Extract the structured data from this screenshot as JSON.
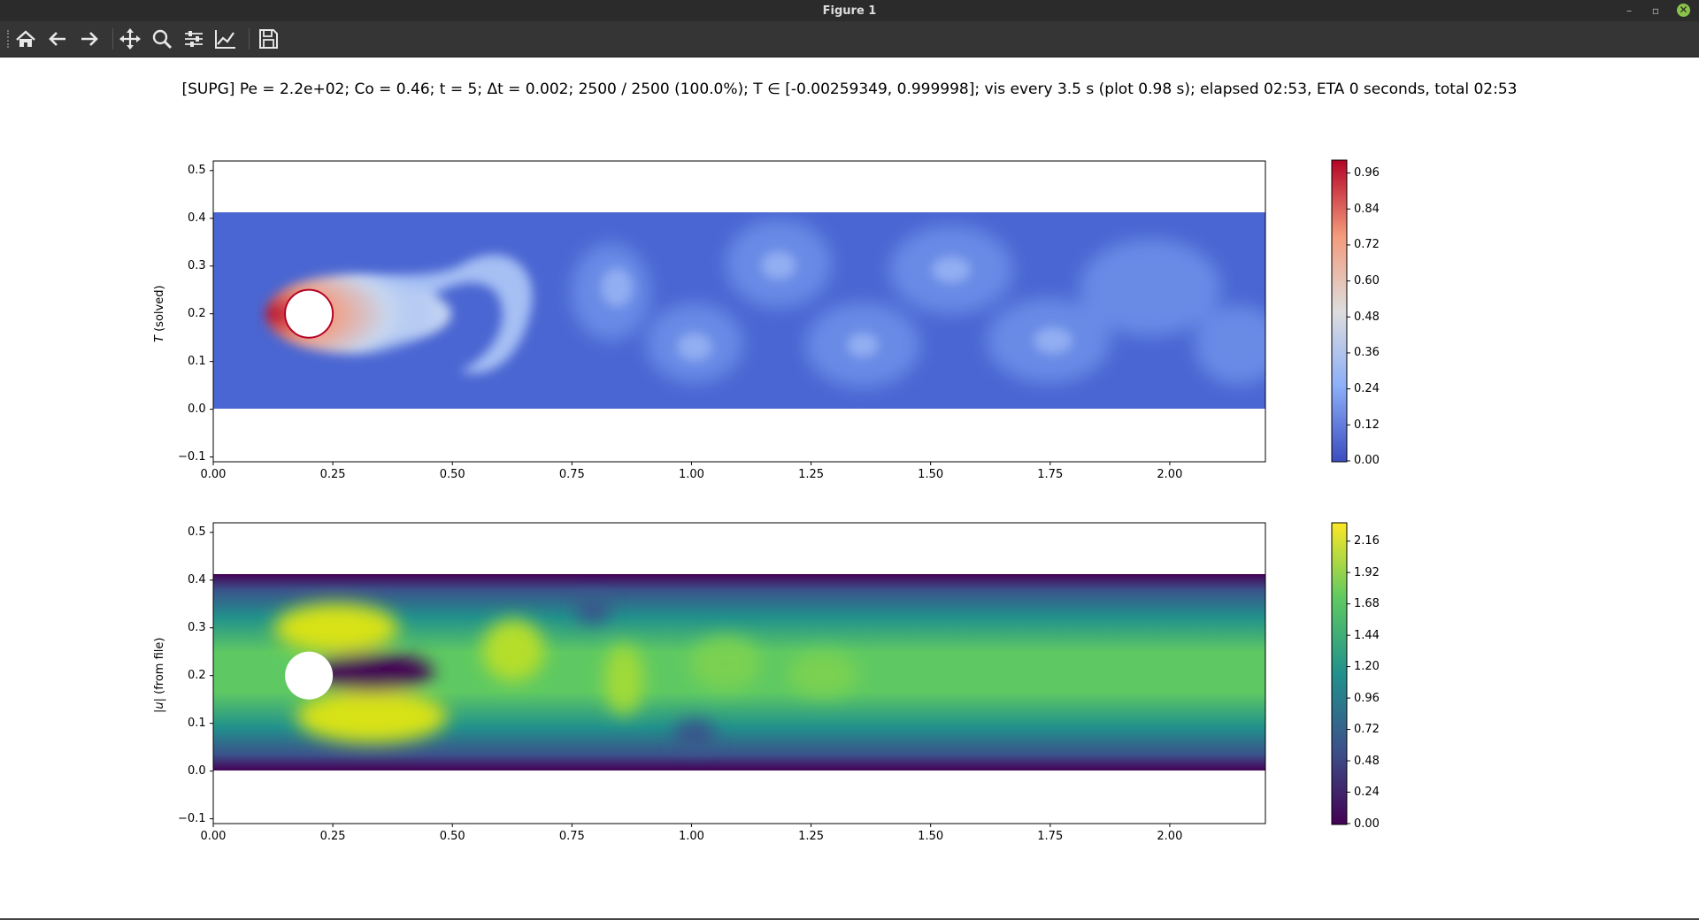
{
  "window": {
    "title": "Figure 1"
  },
  "toolbar": {
    "buttons": [
      {
        "name": "home-icon",
        "tooltip": "Home"
      },
      {
        "name": "back-icon",
        "tooltip": "Back"
      },
      {
        "name": "forward-icon",
        "tooltip": "Forward"
      },
      {
        "name": "pan-icon",
        "tooltip": "Pan"
      },
      {
        "name": "zoom-icon",
        "tooltip": "Zoom"
      },
      {
        "name": "subplots-icon",
        "tooltip": "Configure subplots"
      },
      {
        "name": "axes-edit-icon",
        "tooltip": "Edit axes"
      },
      {
        "name": "save-icon",
        "tooltip": "Save"
      }
    ]
  },
  "figure": {
    "title": "[SUPG] Pe = 2.2e+02; Co = 0.46; t = 5; Δt = 0.002; 2500 / 2500 (100.0%); T ∈ [-0.00259349, 0.999998]; vis every 3.5 s (plot 0.98 s); elapsed 02:53, ETA 0 seconds, total 02:53"
  },
  "chart_data": [
    {
      "type": "heatmap",
      "ylabel_math": "T",
      "ylabel_rest": "(solved)",
      "xlim": [
        0.0,
        2.2
      ],
      "ylim": [
        -0.11,
        0.52
      ],
      "xticks": [
        "0.00",
        "0.25",
        "0.50",
        "0.75",
        "1.00",
        "1.25",
        "1.50",
        "1.75",
        "2.00"
      ],
      "yticks": [
        "0.5",
        "0.4",
        "0.3",
        "0.2",
        "0.1",
        "0.0",
        "−0.1"
      ],
      "colormap": "coolwarm",
      "colorbar_ticks": [
        "0.96",
        "0.84",
        "0.72",
        "0.60",
        "0.48",
        "0.36",
        "0.24",
        "0.12",
        "0.00"
      ],
      "colorbar_range": [
        -0.003,
        1.0
      ],
      "domain": {
        "x": [
          0.0,
          2.2
        ],
        "y": [
          0.0,
          0.41
        ]
      },
      "obstacle": {
        "cx": 0.2,
        "cy": 0.2,
        "r": 0.05
      }
    },
    {
      "type": "heatmap",
      "ylabel_math": "|u|",
      "ylabel_rest": "(from file)",
      "xlim": [
        0.0,
        2.2
      ],
      "ylim": [
        -0.11,
        0.52
      ],
      "xticks": [
        "0.00",
        "0.25",
        "0.50",
        "0.75",
        "1.00",
        "1.25",
        "1.50",
        "1.75",
        "2.00"
      ],
      "yticks": [
        "0.5",
        "0.4",
        "0.3",
        "0.2",
        "0.1",
        "0.0",
        "−0.1"
      ],
      "colormap": "viridis",
      "colorbar_ticks": [
        "2.16",
        "1.92",
        "1.68",
        "1.44",
        "1.20",
        "0.96",
        "0.72",
        "0.48",
        "0.24",
        "0.00"
      ],
      "colorbar_range": [
        0.0,
        2.3
      ],
      "domain": {
        "x": [
          0.0,
          2.2
        ],
        "y": [
          0.0,
          0.41
        ]
      },
      "obstacle": {
        "cx": 0.2,
        "cy": 0.2,
        "r": 0.05
      }
    }
  ]
}
